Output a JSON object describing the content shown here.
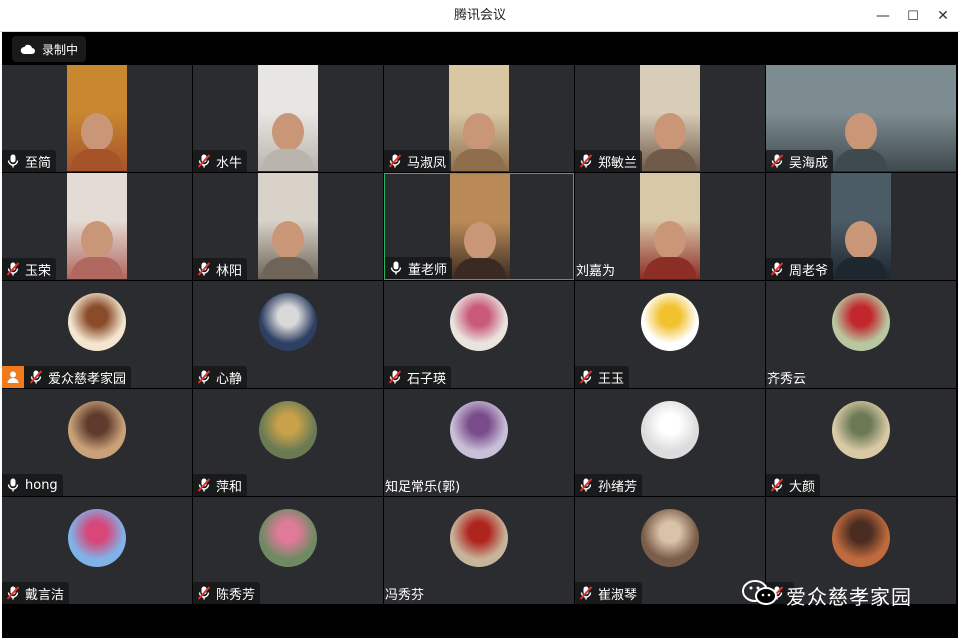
{
  "window": {
    "title": "腾讯会议",
    "controls": {
      "minimize": "—",
      "maximize": "☐",
      "close": "✕"
    }
  },
  "recording": {
    "label": "录制中",
    "icon": "cloud-icon"
  },
  "watermark": {
    "text": "爱众慈孝家园",
    "icon": "wechat-icon"
  },
  "colors": {
    "tile_bg": "#2b2c2f",
    "active_border": "#27b565",
    "host_badge": "#f07a1c",
    "mic_muted": "#e0312c"
  },
  "participants": [
    {
      "name": "至简",
      "mic": "on",
      "media": "video"
    },
    {
      "name": "水牛",
      "mic": "muted",
      "media": "video"
    },
    {
      "name": "马淑凤",
      "mic": "muted",
      "media": "video"
    },
    {
      "name": "郑敏兰",
      "mic": "muted",
      "media": "video"
    },
    {
      "name": "吴海成",
      "mic": "muted",
      "media": "video"
    },
    {
      "name": "玉荣",
      "mic": "muted",
      "media": "video"
    },
    {
      "name": "林阳",
      "mic": "muted",
      "media": "video"
    },
    {
      "name": "董老师",
      "mic": "on",
      "media": "video",
      "active": true
    },
    {
      "name": "刘嘉为",
      "mic": "none",
      "media": "video"
    },
    {
      "name": "周老爷",
      "mic": "muted",
      "media": "video"
    },
    {
      "name": "爱众慈孝家园",
      "mic": "muted",
      "media": "avatar",
      "host": true
    },
    {
      "name": "心静",
      "mic": "muted",
      "media": "avatar"
    },
    {
      "name": "石子瑛",
      "mic": "muted",
      "media": "avatar"
    },
    {
      "name": "王玉",
      "mic": "muted",
      "media": "avatar"
    },
    {
      "name": "齐秀云",
      "mic": "none",
      "media": "avatar"
    },
    {
      "name": "hong",
      "mic": "on",
      "media": "avatar"
    },
    {
      "name": "萍和",
      "mic": "muted",
      "media": "avatar"
    },
    {
      "name": "知足常乐(郭)",
      "mic": "none",
      "media": "avatar"
    },
    {
      "name": "孙绪芳",
      "mic": "muted",
      "media": "avatar"
    },
    {
      "name": "大颜",
      "mic": "muted",
      "media": "avatar"
    },
    {
      "name": "戴言洁",
      "mic": "muted",
      "media": "avatar"
    },
    {
      "name": "陈秀芳",
      "mic": "muted",
      "media": "avatar"
    },
    {
      "name": "冯秀芬",
      "mic": "none",
      "media": "avatar"
    },
    {
      "name": "崔淑琴",
      "mic": "muted",
      "media": "avatar"
    },
    {
      "name": "",
      "mic": "muted",
      "media": "avatar"
    }
  ]
}
